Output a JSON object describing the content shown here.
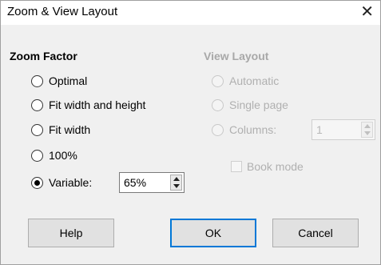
{
  "window": {
    "title": "Zoom & View Layout",
    "close_symbol": "✕"
  },
  "zoom_factor": {
    "heading": "Zoom Factor",
    "options": [
      {
        "label": "Optimal",
        "checked": false
      },
      {
        "label": "Fit width and height",
        "checked": false
      },
      {
        "label": "Fit width",
        "checked": false
      },
      {
        "label": "100%",
        "checked": false
      },
      {
        "label": "Variable:",
        "checked": true
      }
    ],
    "variable_value": "65%"
  },
  "view_layout": {
    "heading": "View Layout",
    "options": [
      {
        "label": "Automatic",
        "enabled": false
      },
      {
        "label": "Single page",
        "enabled": false
      },
      {
        "label": "Columns:",
        "enabled": false
      }
    ],
    "columns_value": "1",
    "book_mode_label": "Book mode"
  },
  "buttons": {
    "help": "Help",
    "ok": "OK",
    "cancel": "Cancel"
  }
}
